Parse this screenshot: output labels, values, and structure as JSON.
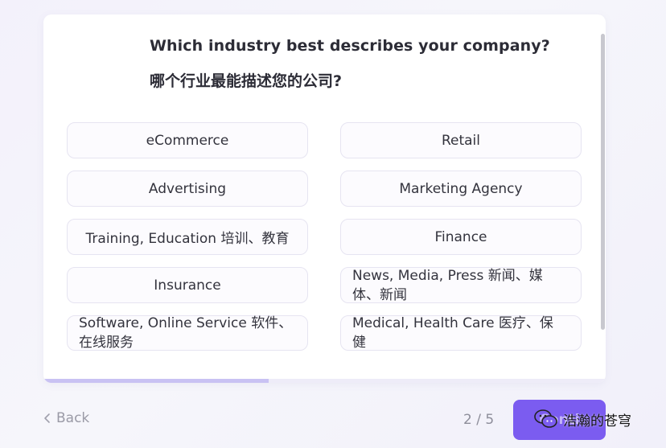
{
  "question": {
    "english": "Which industry best describes your company?",
    "chinese": "哪个行业最能描述您的公司?"
  },
  "options": [
    {
      "label": "eCommerce"
    },
    {
      "label": "Retail"
    },
    {
      "label": "Advertising"
    },
    {
      "label": "Marketing Agency"
    },
    {
      "label": "Training, Education 培训、教育"
    },
    {
      "label": "Finance"
    },
    {
      "label": "Insurance"
    },
    {
      "label_line1": "News, Media, Press 新闻、媒",
      "label_line2": "体、新闻"
    },
    {
      "label_line1": "Software, Online Service 软件、",
      "label_line2": "在线服务"
    },
    {
      "label_line1": "Medical, Health Care 医疗、保",
      "label_line2": "健"
    }
  ],
  "progress": {
    "fraction": 0.4
  },
  "footer": {
    "back_label": "Back",
    "pager": "2 / 5",
    "continue_label": "Conti",
    "watermark": "浩瀚的苍穹"
  },
  "colors": {
    "accent": "#7b5cf0",
    "progress": "#c9c2f3"
  }
}
